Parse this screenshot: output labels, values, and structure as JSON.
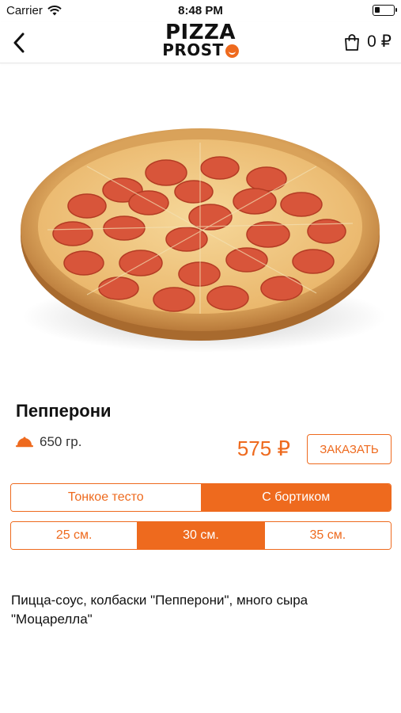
{
  "status_bar": {
    "carrier": "Carrier",
    "time": "8:48 PM",
    "battery_level": 0.25
  },
  "header": {
    "logo_line1": "PIZZA",
    "logo_line2": "PROST",
    "cart_total": "0 ₽",
    "icons": {
      "back": "chevron-left-icon",
      "cart": "shopping-bag-icon"
    }
  },
  "product": {
    "name": "Пепперони",
    "weight": "650 гр.",
    "price": "575 ₽",
    "order_label": "ЗАКАЗАТЬ",
    "crust_options": [
      {
        "label": "Тонкое тесто",
        "selected": false
      },
      {
        "label": "С бортиком",
        "selected": true
      }
    ],
    "size_options": [
      {
        "label": "25 см.",
        "selected": false
      },
      {
        "label": "30 см.",
        "selected": true
      },
      {
        "label": "35 см.",
        "selected": false
      }
    ],
    "description": "Пицца-соус, колбаски \"Пепперони\", много сыра \"Моцарелла\""
  },
  "colors": {
    "accent": "#ee6a1e",
    "text": "#111111"
  }
}
